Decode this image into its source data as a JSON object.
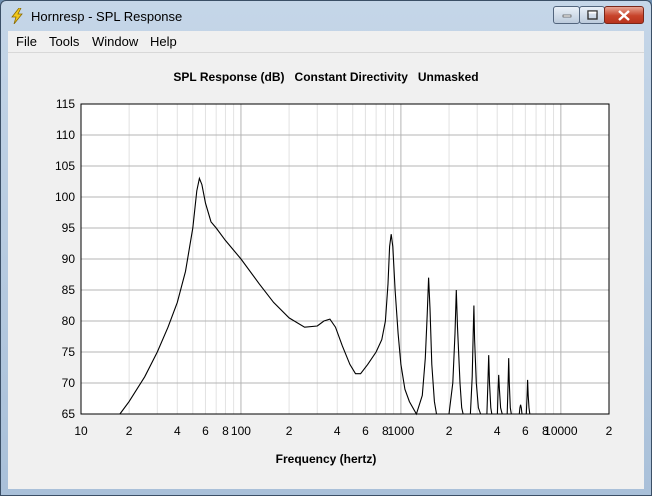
{
  "window": {
    "title": "Hornresp - SPL Response"
  },
  "menu": {
    "items": [
      "File",
      "Tools",
      "Window",
      "Help"
    ]
  },
  "chart_data": {
    "type": "line",
    "title": "SPL Response (dB)   Constant Directivity   Unmasked",
    "xlabel": "Frequency (hertz)",
    "ylabel": "",
    "x_scale": "log",
    "xlim": [
      10,
      20000
    ],
    "ylim": [
      65,
      115
    ],
    "grid": true,
    "y_ticks": [
      115,
      110,
      105,
      100,
      95,
      90,
      85,
      80,
      75,
      70,
      65
    ],
    "x_ticks": [
      {
        "value": 10,
        "label": "10"
      },
      {
        "value": 20,
        "label": "2"
      },
      {
        "value": 40,
        "label": "4"
      },
      {
        "value": 60,
        "label": "6"
      },
      {
        "value": 80,
        "label": "8"
      },
      {
        "value": 100,
        "label": "100"
      },
      {
        "value": 200,
        "label": "2"
      },
      {
        "value": 400,
        "label": "4"
      },
      {
        "value": 600,
        "label": "6"
      },
      {
        "value": 800,
        "label": "8"
      },
      {
        "value": 1000,
        "label": "1000"
      },
      {
        "value": 2000,
        "label": "2"
      },
      {
        "value": 4000,
        "label": "4"
      },
      {
        "value": 6000,
        "label": "6"
      },
      {
        "value": 8000,
        "label": "8"
      },
      {
        "value": 10000,
        "label": "10000"
      },
      {
        "value": 20000,
        "label": "2"
      }
    ],
    "series": [
      {
        "points": [
          [
            17.5,
            65
          ],
          [
            20,
            67
          ],
          [
            25,
            71
          ],
          [
            30,
            75
          ],
          [
            35,
            79
          ],
          [
            40,
            83
          ],
          [
            45,
            88
          ],
          [
            50,
            95
          ],
          [
            53,
            101
          ],
          [
            55,
            103
          ],
          [
            57,
            102
          ],
          [
            60,
            99
          ],
          [
            65,
            96
          ],
          [
            70,
            95
          ],
          [
            80,
            93
          ],
          [
            100,
            90
          ],
          [
            130,
            86
          ],
          [
            160,
            83
          ],
          [
            200,
            80.5
          ],
          [
            250,
            79
          ],
          [
            300,
            79.2
          ],
          [
            330,
            80
          ],
          [
            360,
            80.3
          ],
          [
            390,
            79
          ],
          [
            430,
            76
          ],
          [
            480,
            73
          ],
          [
            520,
            71.5
          ],
          [
            560,
            71.5
          ],
          [
            620,
            73
          ],
          [
            700,
            75
          ],
          [
            760,
            77
          ],
          [
            800,
            80
          ],
          [
            830,
            86
          ],
          [
            850,
            92
          ],
          [
            870,
            94
          ],
          [
            890,
            92
          ],
          [
            920,
            85
          ],
          [
            960,
            78
          ],
          [
            1000,
            73
          ],
          [
            1060,
            69
          ],
          [
            1130,
            67
          ],
          [
            1250,
            65
          ],
          [
            1360,
            68
          ],
          [
            1420,
            74
          ],
          [
            1460,
            81
          ],
          [
            1490,
            87
          ],
          [
            1520,
            82
          ],
          [
            1560,
            73
          ],
          [
            1620,
            67
          ],
          [
            1670,
            65
          ],
          [
            2000,
            65
          ],
          [
            2110,
            70
          ],
          [
            2180,
            78
          ],
          [
            2220,
            85
          ],
          [
            2260,
            79
          ],
          [
            2340,
            70
          ],
          [
            2400,
            66
          ],
          [
            2450,
            65
          ],
          [
            2720,
            65
          ],
          [
            2790,
            71
          ],
          [
            2830,
            78
          ],
          [
            2860,
            82.5
          ],
          [
            2890,
            77
          ],
          [
            2960,
            70
          ],
          [
            3050,
            66
          ],
          [
            3150,
            65
          ],
          [
            3450,
            65
          ],
          [
            3500,
            70
          ],
          [
            3540,
            74.5
          ],
          [
            3580,
            70
          ],
          [
            3650,
            66
          ],
          [
            3700,
            65
          ],
          [
            4010,
            65
          ],
          [
            4050,
            69
          ],
          [
            4090,
            71.3
          ],
          [
            4130,
            69
          ],
          [
            4200,
            66
          ],
          [
            4300,
            65
          ],
          [
            4620,
            65
          ],
          [
            4680,
            70
          ],
          [
            4720,
            74
          ],
          [
            4760,
            70
          ],
          [
            4830,
            66
          ],
          [
            4900,
            65
          ],
          [
            5500,
            65
          ],
          [
            5550,
            66
          ],
          [
            5600,
            66.5
          ],
          [
            5660,
            66
          ],
          [
            5720,
            65
          ],
          [
            6080,
            65
          ],
          [
            6150,
            68
          ],
          [
            6200,
            70.5
          ],
          [
            6250,
            68
          ],
          [
            6320,
            66
          ],
          [
            6400,
            65
          ]
        ]
      }
    ]
  }
}
